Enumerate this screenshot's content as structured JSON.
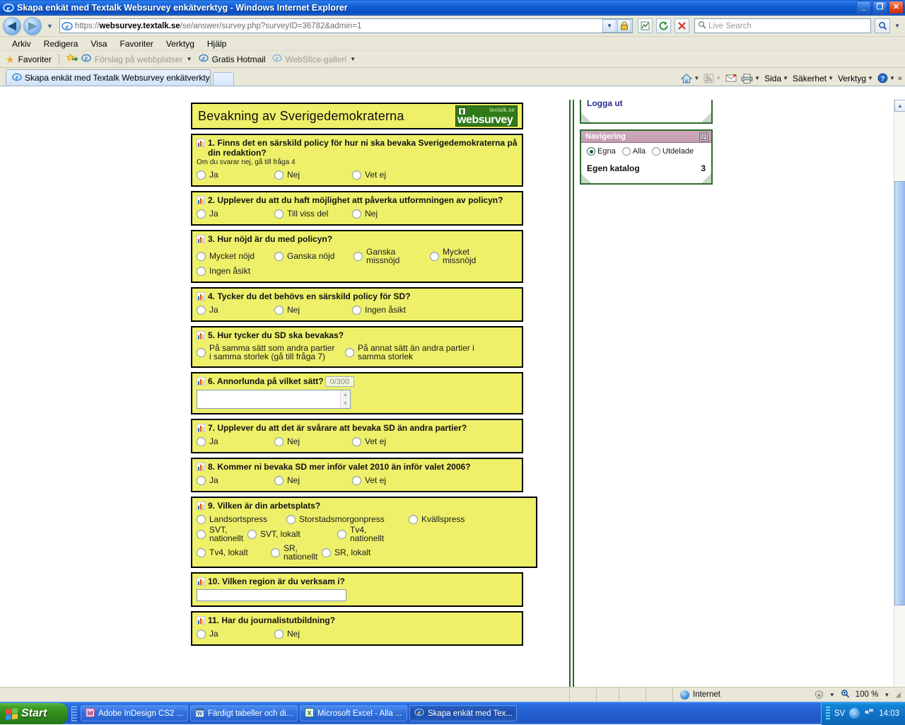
{
  "window": {
    "title": "Skapa enkät med Textalk Websurvey enkätverktyg - Windows Internet Explorer",
    "minimize_label": "_",
    "restore_label": "❐",
    "close_label": "✕"
  },
  "nav": {
    "back_label": "◀",
    "forward_label": "▶",
    "history_caret": "▼",
    "url_prefix": "https://",
    "url_host": "websurvey.textalk.se",
    "url_path": "/se/answer/survey.php?surveyID=36782&admin=1",
    "url_full": "https://websurvey.textalk.se/se/answer/survey.php?surveyID=36782&admin=1",
    "addr_dropdown": "▼",
    "lock_icon": "lock",
    "compat_icon": "compatibility-view",
    "refresh_icon": "↻",
    "stop_icon": "✕",
    "search_placeholder": "Live Search",
    "search_value": "",
    "search_go_icon": "search",
    "search_caret": "▼"
  },
  "menubar": {
    "items": [
      "Arkiv",
      "Redigera",
      "Visa",
      "Favoriter",
      "Verktyg",
      "Hjälp"
    ]
  },
  "favbar": {
    "favorites_label": "Favoriter",
    "add_icon": "add-favorite-icon",
    "items": [
      {
        "label": "Förslag på webbplatser",
        "dimmed": true,
        "caret": "▼"
      },
      {
        "label": "Gratis Hotmail",
        "dimmed": false,
        "caret": ""
      },
      {
        "label": "WebSlice-galleri",
        "dimmed": true,
        "caret": "▼"
      }
    ]
  },
  "tabs": {
    "active_tab_label": "Skapa enkät med Textalk Websurvey enkätverktyg",
    "new_tab_label": ""
  },
  "command_bar": {
    "home_caret": "▼",
    "feeds_caret": "▼",
    "mail_caret": "",
    "print_caret": "▼",
    "items": [
      {
        "label": "Sida",
        "caret": "▼"
      },
      {
        "label": "Säkerhet",
        "caret": "▼"
      },
      {
        "label": "Verktyg",
        "caret": "▼"
      },
      {
        "label": "",
        "caret": "▼"
      }
    ],
    "overflow": "»"
  },
  "survey": {
    "title": "Bevakning av Sverigedemokraterna",
    "logo": {
      "tagline": "textalk.se",
      "word_a": "web",
      "word_b": "survey",
      "badge": "▮"
    },
    "questions": [
      {
        "number": "1.",
        "text": "Finns det en särskild policy för hur ni ska bevaka Sverigedemokraterna på din redaktion?",
        "subtext": "Om du svarar nej, gå till fråga 4",
        "type": "radio",
        "options": [
          "Ja",
          "Nej",
          "Vet ej"
        ]
      },
      {
        "number": "2.",
        "text": "Upplever du att du haft möjlighet att påverka utformningen av policyn?",
        "subtext": "",
        "type": "radio",
        "options": [
          "Ja",
          "Till viss del",
          "Nej"
        ]
      },
      {
        "number": "3.",
        "text": "Hur nöjd är du med policyn?",
        "subtext": "",
        "type": "radio",
        "options": [
          "Mycket nöjd",
          "Ganska nöjd",
          "Ganska missnöjd",
          "Mycket missnöjd",
          "Ingen åsikt"
        ]
      },
      {
        "number": "4.",
        "text": "Tycker du det behövs en särskild policy för SD?",
        "subtext": "",
        "type": "radio",
        "options": [
          "Ja",
          "Nej",
          "Ingen åsikt"
        ]
      },
      {
        "number": "5.",
        "text": "Hur tycker du SD ska bevakas?",
        "subtext": "",
        "type": "radio",
        "options": [
          "På samma sätt som andra partier i samma storlek (gå till fråga 7)",
          "På annat sätt än andra partier i samma storlek"
        ]
      },
      {
        "number": "6.",
        "text": "Annorlunda på vilket sätt?",
        "subtext": "",
        "type": "textarea",
        "counter": "0/300",
        "value": ""
      },
      {
        "number": "7.",
        "text": "Upplever du att det är svårare att bevaka SD än andra partier?",
        "subtext": "",
        "type": "radio",
        "options": [
          "Ja",
          "Nej",
          "Vet ej"
        ]
      },
      {
        "number": "8.",
        "text": "Kommer ni bevaka SD mer inför valet 2010 än inför valet 2006?",
        "subtext": "",
        "type": "radio",
        "options": [
          "Ja",
          "Nej",
          "Vet ej"
        ]
      },
      {
        "number": "9.",
        "text": "Vilken är din arbetsplats?",
        "subtext": "",
        "type": "radio",
        "options": [
          "Landsortspress",
          "Storstadsmorgonpress",
          "Kvällspress",
          "SVT, nationellt",
          "SVT, lokalt",
          "Tv4, nationellt",
          "Tv4, lokalt",
          "SR, nationellt",
          "SR, lokalt"
        ]
      },
      {
        "number": "10.",
        "text": "Vilken region är du verksam i?",
        "subtext": "",
        "type": "text",
        "value": ""
      },
      {
        "number": "11.",
        "text": "Har du journalistutbildning?",
        "subtext": "",
        "type": "radio",
        "options": [
          "Ja",
          "Nej"
        ]
      }
    ]
  },
  "sidebar": {
    "logout_label": "Logga ut",
    "nav_panel": {
      "title": "Navigering",
      "head_button_icon": "panel-toggle-icon",
      "radios": [
        {
          "label": "Egna",
          "selected": true
        },
        {
          "label": "Alla",
          "selected": false
        },
        {
          "label": "Utdelade",
          "selected": false
        }
      ],
      "catalog_label": "Egen katalog",
      "catalog_count": "3"
    }
  },
  "statusbar": {
    "zone_label": "Internet",
    "zone_icon": "globe-icon",
    "protected_icon": "protected-mode-icon",
    "protected_caret": "▼",
    "zoom_label": "100 %",
    "zoom_caret": "▼"
  },
  "taskbar": {
    "start_label": "Start",
    "items": [
      {
        "label": "Adobe InDesign CS2 ...",
        "icon": "indesign-icon",
        "active": false
      },
      {
        "label": "Färdigt tabeller och di...",
        "icon": "word-icon",
        "active": false
      },
      {
        "label": "Microsoft Excel - Alla ...",
        "icon": "excel-icon",
        "active": false
      },
      {
        "label": "Skapa enkät med Tex...",
        "icon": "ie-icon",
        "active": true
      }
    ],
    "tray": {
      "language": "SV",
      "clock": "14:03"
    }
  },
  "scrollbar": {
    "up_arrow": "▲",
    "down_arrow": "▼"
  }
}
